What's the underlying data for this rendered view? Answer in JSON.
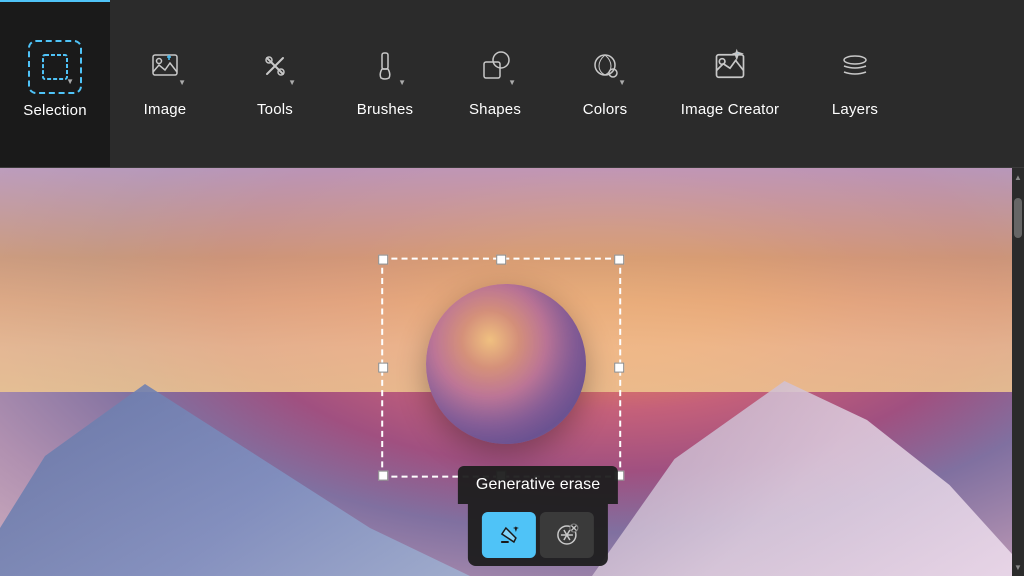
{
  "toolbar": {
    "items": [
      {
        "id": "selection",
        "label": "Selection",
        "active": true,
        "has_chevron": true
      },
      {
        "id": "image",
        "label": "Image",
        "active": false,
        "has_chevron": true
      },
      {
        "id": "tools",
        "label": "Tools",
        "active": false,
        "has_chevron": true
      },
      {
        "id": "brushes",
        "label": "Brushes",
        "active": false,
        "has_chevron": true
      },
      {
        "id": "shapes",
        "label": "Shapes",
        "active": false,
        "has_chevron": true
      },
      {
        "id": "colors",
        "label": "Colors",
        "active": false,
        "has_chevron": true
      },
      {
        "id": "image_creator",
        "label": "Image Creator",
        "active": false,
        "has_chevron": false
      },
      {
        "id": "layers",
        "label": "Layers",
        "active": false,
        "has_chevron": false
      }
    ]
  },
  "context_menu": {
    "label": "Generative erase",
    "buttons": [
      {
        "id": "generative-erase-btn",
        "active": true,
        "icon": "erase-sparkle"
      },
      {
        "id": "erase-pattern-btn",
        "active": false,
        "icon": "erase-pattern"
      }
    ]
  }
}
